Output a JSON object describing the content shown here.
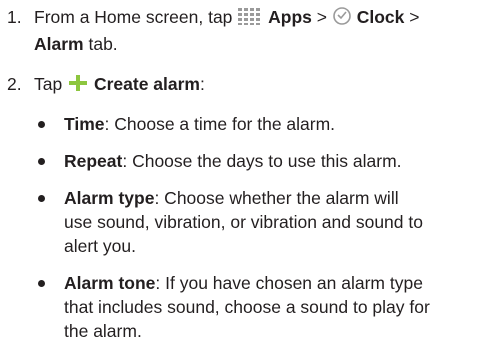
{
  "steps": [
    {
      "number": "1.",
      "prefix": "From a Home screen, tap ",
      "apps_label": "Apps",
      "sep1": " > ",
      "clock_label": "Clock",
      "sep2": " >",
      "alarm_label": "Alarm",
      "suffix": " tab."
    },
    {
      "number": "2.",
      "prefix": "Tap ",
      "create_label": "Create alarm",
      "suffix": ":"
    }
  ],
  "bullets": [
    {
      "term": "Time",
      "line1": ": Choose a time for the alarm.",
      "lines": []
    },
    {
      "term": "Repeat",
      "line1": ": Choose the days to use this alarm.",
      "lines": []
    },
    {
      "term": "Alarm type",
      "line1": ": Choose whether the alarm will",
      "lines": [
        "use sound, vibration, or vibration and sound to",
        "alert you."
      ]
    },
    {
      "term": "Alarm tone",
      "line1": ": If you have chosen an alarm type",
      "lines": [
        "that includes sound, choose a sound to play for",
        "the alarm."
      ]
    }
  ],
  "icons": {
    "apps": "apps-grid-icon",
    "clock": "clock-icon",
    "plus": "plus-icon",
    "accent": "#8dc63f",
    "grey": "#9a9a9a"
  }
}
